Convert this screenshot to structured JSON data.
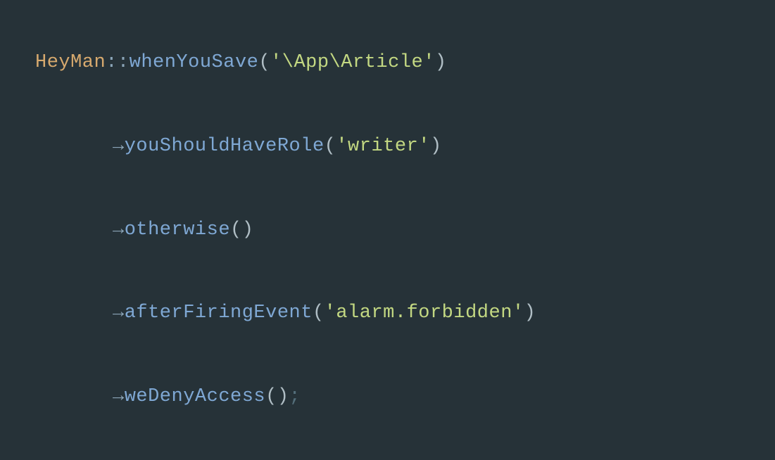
{
  "code": {
    "class_name": "HeyMan",
    "scope_resolution": "::",
    "method_1": "whenYouSave",
    "string_1": "'\\App\\Article'",
    "arrow": "→",
    "method_2": "youShouldHaveRole",
    "string_2": "'writer'",
    "method_3": "otherwise",
    "method_4": "afterFiringEvent",
    "string_3": "'alarm.forbidden'",
    "method_5": "weDenyAccess",
    "open_paren": "(",
    "close_paren": ")",
    "semicolon": ";"
  }
}
